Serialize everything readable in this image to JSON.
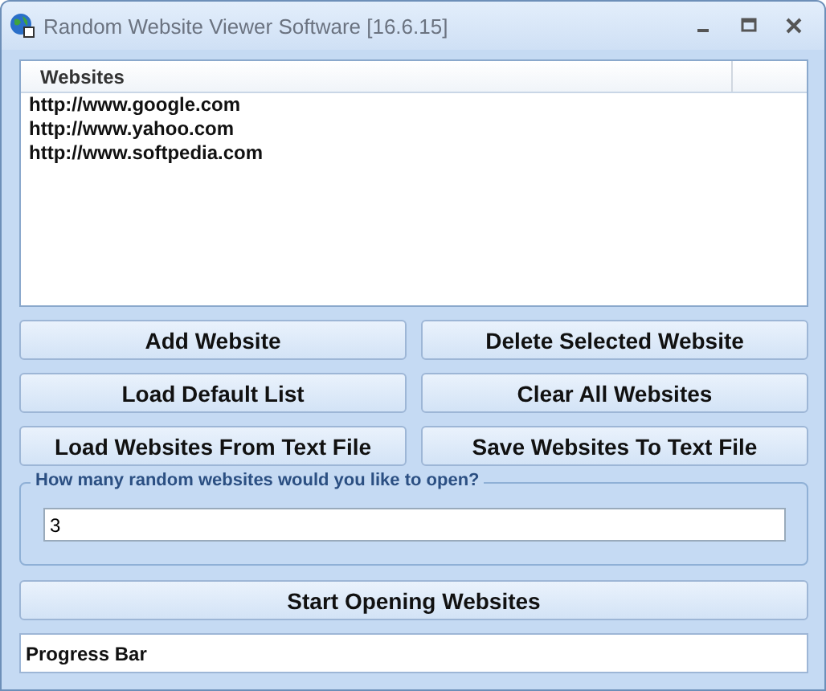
{
  "window": {
    "title": "Random Website Viewer Software [16.6.15]"
  },
  "website_list": {
    "column": "Websites",
    "rows": [
      "http://www.google.com",
      "http://www.yahoo.com",
      "http://www.softpedia.com"
    ]
  },
  "buttons": [
    "Add Website",
    "Delete Selected Website",
    "Load Default List",
    "Clear All Websites",
    "Load Websites From Text File",
    "Save Websites To Text File"
  ],
  "count_group": {
    "label": "How many random websites would you like to open?",
    "value": "3"
  },
  "start_button": "Start Opening Websites",
  "progress": {
    "text": "Progress Bar"
  }
}
